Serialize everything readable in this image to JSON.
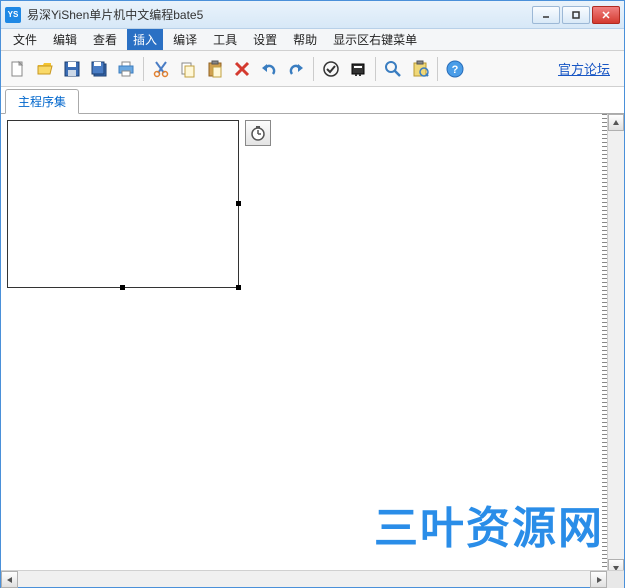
{
  "window": {
    "title": "易深YiShen单片机中文编程bate5"
  },
  "menus": {
    "file": "文件",
    "edit": "编辑",
    "view": "查看",
    "insert": "插入",
    "compile": "编译",
    "tools": "工具",
    "settings": "设置",
    "help": "帮助",
    "context": "显示区右键菜单"
  },
  "toolbar": {
    "new": "new",
    "open": "open",
    "save": "save",
    "saveall": "saveall",
    "print": "print",
    "cut": "cut",
    "copy": "copy",
    "paste": "paste",
    "delete": "delete",
    "undo": "undo",
    "redo": "redo",
    "check": "check",
    "build": "build",
    "find": "find",
    "clipboard": "clipboard",
    "helpbtn": "help"
  },
  "forum_link": "官方论坛",
  "tab": {
    "main": "主程序集"
  },
  "watermark": "三叶资源网"
}
